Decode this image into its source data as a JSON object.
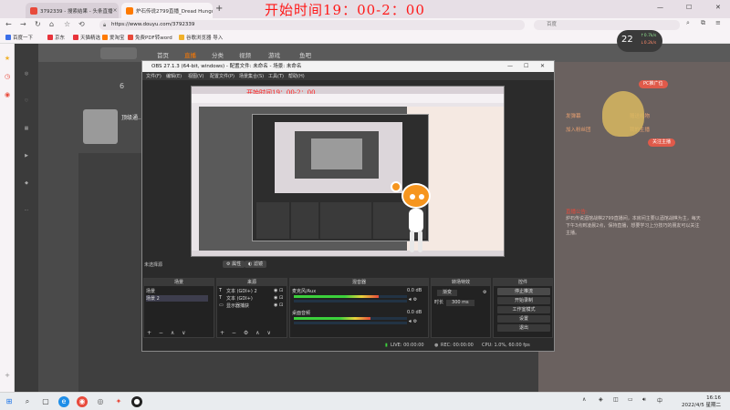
{
  "overlay_title": "开始时间19：00-2：00",
  "browser": {
    "tabs": [
      {
        "label": "3792339 - 搜索结果 - 头条直播",
        "color": "#e84a3b"
      },
      {
        "label": "炉石传说2799直播_Dread Hungu...",
        "color": "#ff7a00"
      }
    ],
    "url": "https://www.douyu.com/3792339",
    "search_placeholder": "百度",
    "bookmarks": [
      "百度一下",
      "京东",
      "天猫精选",
      "爱淘宝",
      "免费PDF转word",
      "谷歌浏览器 导入"
    ]
  },
  "douyu": {
    "nav": [
      "首页",
      "直播",
      "分类",
      "视频",
      "游戏",
      "鱼吧"
    ],
    "streamer_name": "顶级通...",
    "followers_label": "6",
    "badge": {
      "value": "22",
      "unit": "%",
      "up": "↑0.7k/s",
      "down": "↓0.2k/s"
    },
    "right_panel": {
      "pc_label": "PC推广位",
      "labels": [
        "发弹幕",
        "赠送礼物",
        "加入粉丝团",
        "我的主播",
        "关注主播"
      ],
      "notice_title": "直播公告:",
      "notice_text": "炉石传说酒馆战棋2799直播间，本房间主要以酒馆战棋为主，每天下午3点到凌晨2点，保持直播，想要学习上分技巧的朋友可以关注主播。"
    }
  },
  "obs": {
    "title": "OBS 27.1.3 (64-bit, windows) - 配置文件: 未命名 - 场景: 未命名",
    "menu": [
      "文件(F)",
      "编辑(E)",
      "视图(V)",
      "配置文件(P)",
      "场景集合(S)",
      "工具(T)",
      "帮助(H)"
    ],
    "preview_title": "开始时间19：00-2：00",
    "below_label": "未选择源",
    "below_buttons": [
      "属性",
      "滤镜"
    ],
    "docks": {
      "scenes": {
        "header": "场景",
        "items": [
          "场景",
          "场景 2"
        ]
      },
      "sources": {
        "header": "来源",
        "items": [
          "文本 (GDI+) 2",
          "文本 (GDI+)",
          "显示器捕获"
        ]
      },
      "mixer": {
        "header": "混音器",
        "channels": [
          {
            "name": "麦克风/Aux",
            "db": "0.0 dB",
            "level": 0.75
          },
          {
            "name": "桌面音频",
            "db": "0.0 dB",
            "level": 0.68
          }
        ]
      },
      "transitions": {
        "header": "转场特效",
        "type": "渐变",
        "duration_label": "时长",
        "duration": "300 ms"
      },
      "controls": {
        "header": "控件",
        "buttons": [
          "停止推流",
          "开始录制",
          "工作室模式",
          "设置",
          "退出"
        ]
      }
    },
    "status": {
      "live": "LIVE: 00:00:00",
      "rec": "REC: 00:00:00",
      "cpu": "CPU: 1.0%, 60.00 fps"
    }
  },
  "taskbar": {
    "time": "16:16",
    "date": "2022/4/5 星期二"
  }
}
